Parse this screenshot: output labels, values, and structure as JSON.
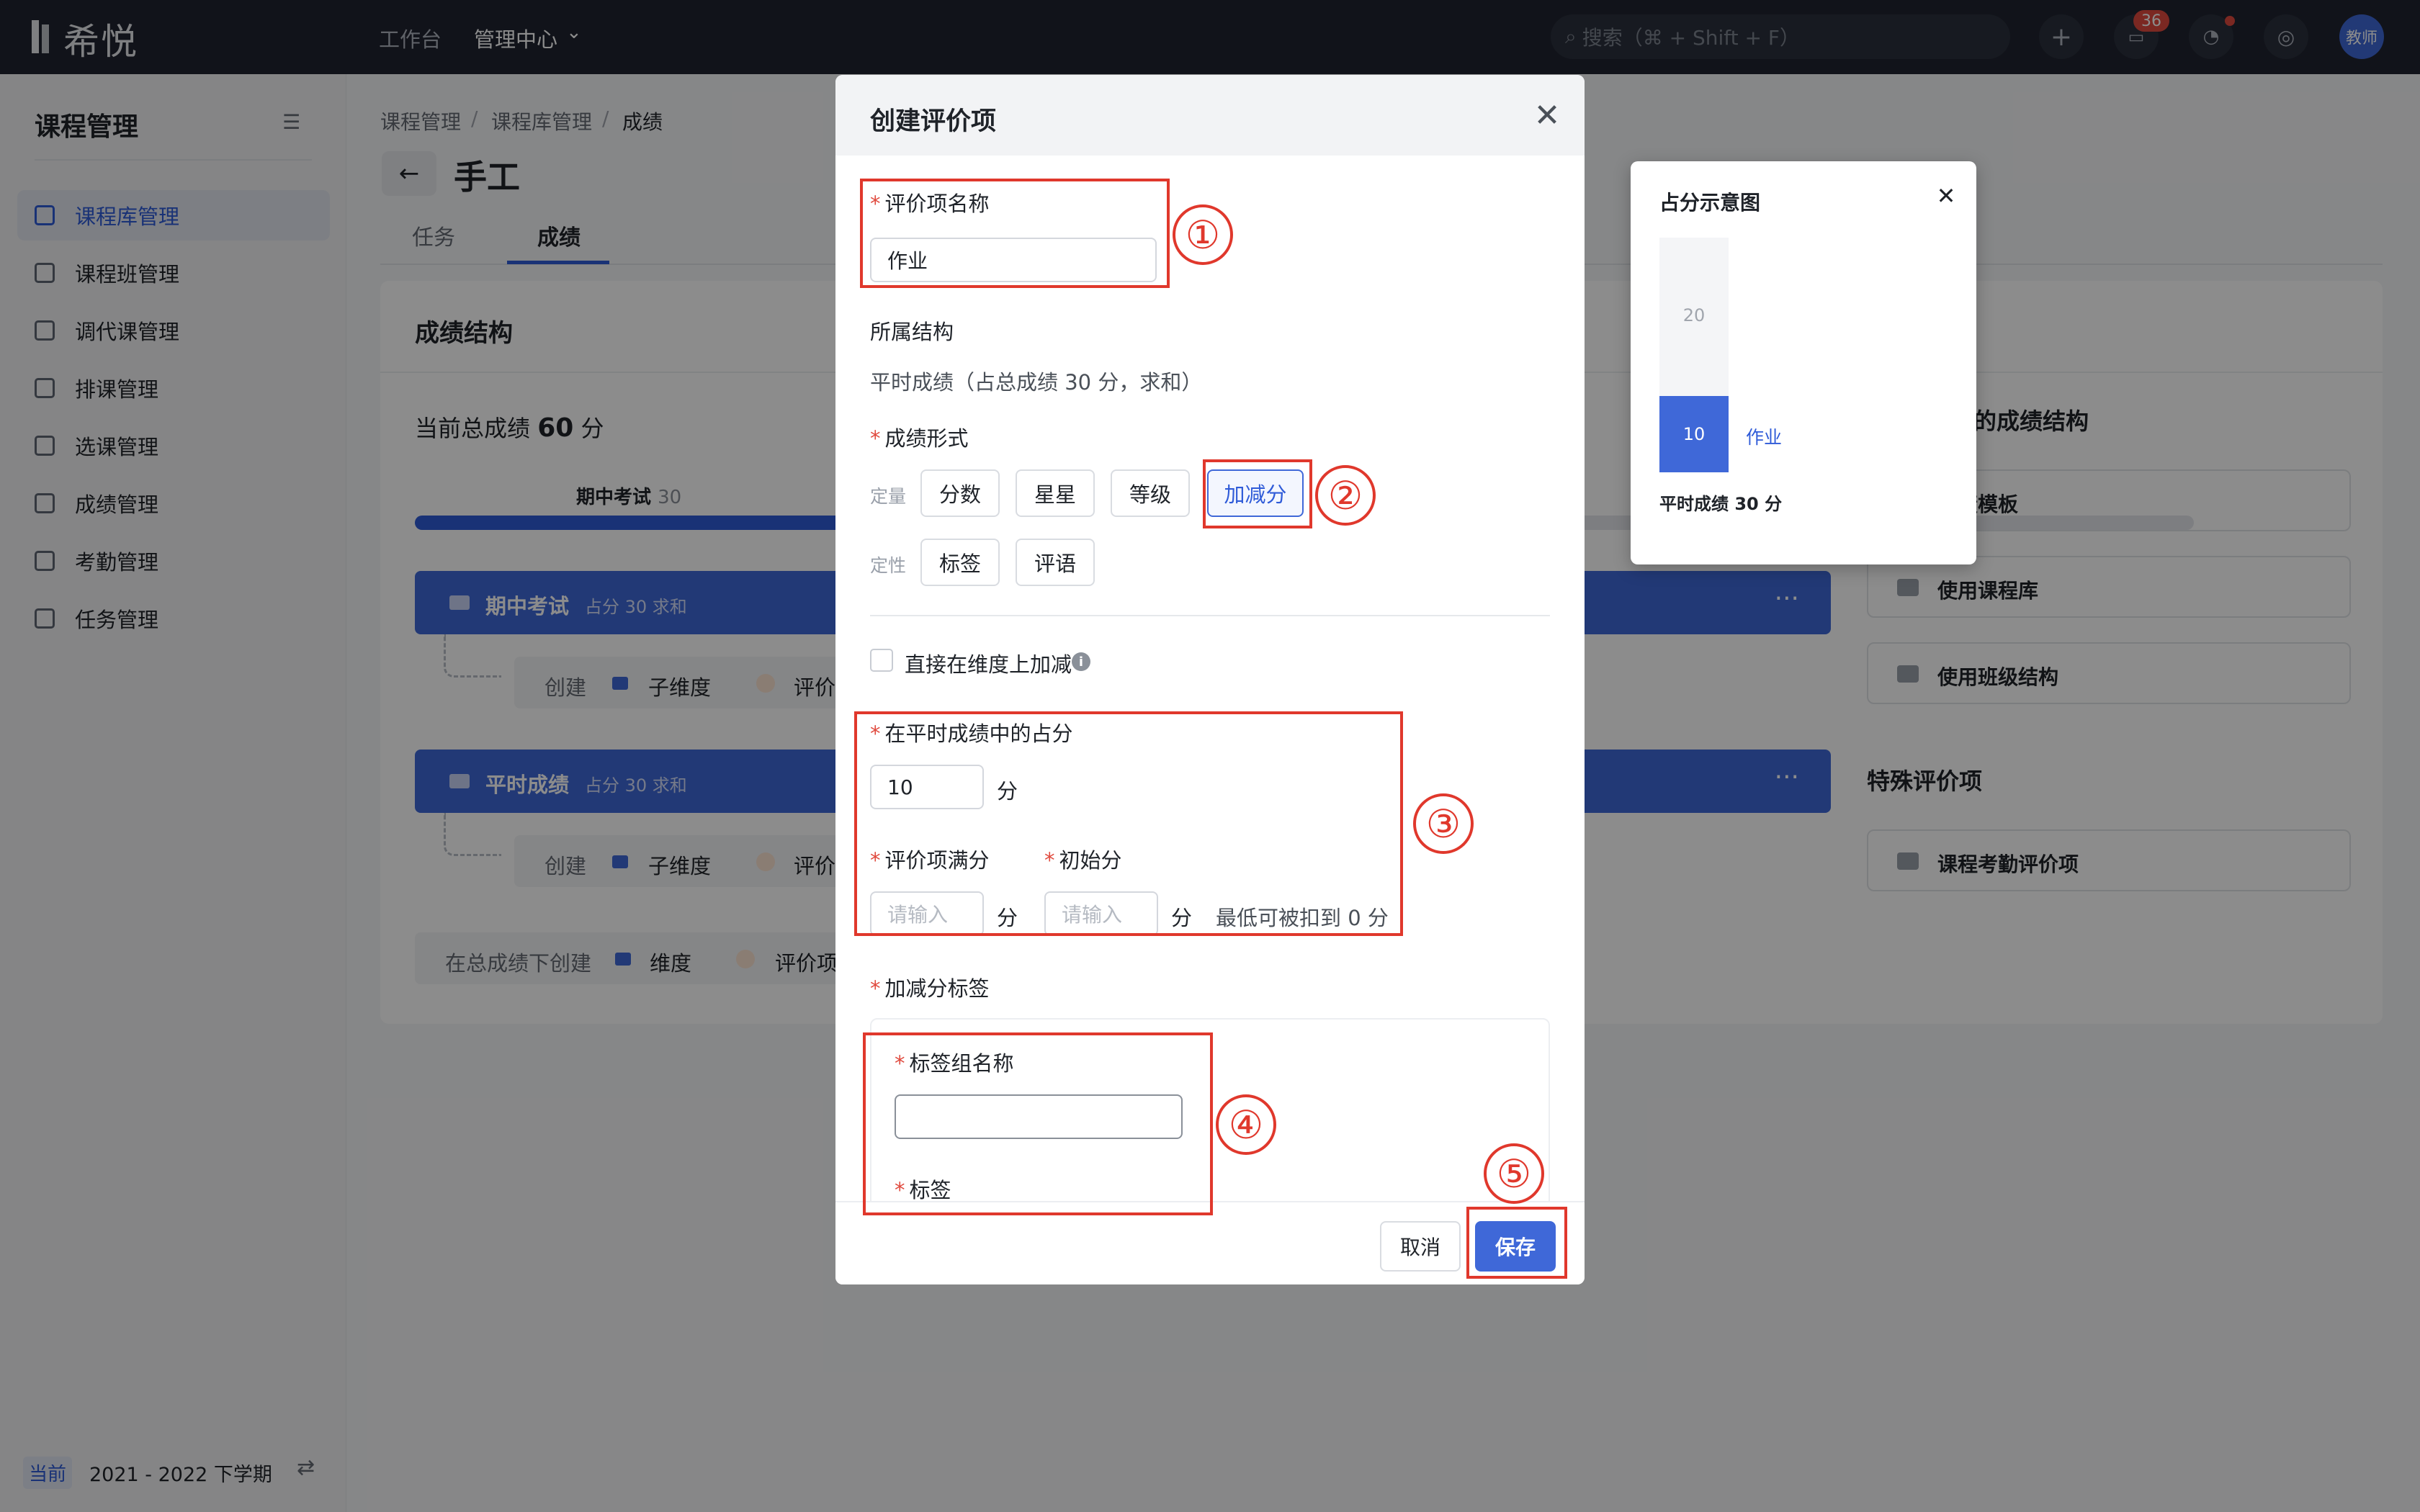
{
  "topbar": {
    "brand": "希悦",
    "nav": [
      "工作台",
      "管理中心"
    ],
    "search_placeholder": "搜索（⌘ + Shift + F）",
    "message_badge": "36",
    "avatar_label": "教师"
  },
  "sidebar": {
    "title": "课程管理",
    "items": [
      "课程库管理",
      "课程班管理",
      "调代课管理",
      "排课管理",
      "选课管理",
      "成绩管理",
      "考勤管理",
      "任务管理"
    ],
    "active_index": 0,
    "term_tag": "当前",
    "term": "2021 - 2022 下学期"
  },
  "main": {
    "breadcrumb": [
      "课程管理",
      "课程库管理",
      "成绩"
    ],
    "breadcrumb_sep": "/",
    "page_title": "手工",
    "tabs": [
      "任务",
      "成绩"
    ],
    "active_tab": 1,
    "section_title": "成绩结构",
    "total_prefix": "当前总成绩",
    "total_value": "60",
    "total_unit": "分",
    "progress": {
      "label": "期中考试",
      "value": "30",
      "fraction": 0.5
    },
    "groups": [
      {
        "name": "期中考试",
        "sub": "占分 30 求和"
      },
      {
        "name": "平时成绩",
        "sub": "占分 30 求和"
      }
    ],
    "subrow": {
      "create": "创建",
      "sub_dim": "子维度",
      "eval": "评价"
    },
    "create_row": {
      "label": "在总成绩下创建",
      "dim": "维度",
      "eval": "评价项"
    },
    "right": {
      "struct_title_partial": "的成绩结构",
      "buttons": [
        "成绩模板",
        "使用课程库",
        "使用班级结构"
      ],
      "special_title": "特殊评价项",
      "special_buttons": [
        "课程考勤评价项"
      ]
    }
  },
  "modal": {
    "title": "创建评价项",
    "close": "✕",
    "name_label": "评价项名称",
    "name_value": "作业",
    "struct_label": "所属结构",
    "struct_value": "平时成绩（占总成绩 30 分，求和）",
    "form_label": "成绩形式",
    "quant_label": "定量",
    "quant_options": [
      "分数",
      "星星",
      "等级",
      "加减分"
    ],
    "qual_label": "定性",
    "qual_options": [
      "标签",
      "评语"
    ],
    "selected_option": "加减分",
    "direct_checkbox": "直接在维度上加减",
    "share_label": "在平时成绩中的占分",
    "share_value": "10",
    "unit": "分",
    "full_label": "评价项满分",
    "full_placeholder": "请输入",
    "init_label": "初始分",
    "init_placeholder": "请输入",
    "min_note": "最低可被扣到 0 分",
    "tags_label": "加减分标签",
    "tag_group_label": "标签组名称",
    "tag_label": "标签",
    "cancel": "取消",
    "save": "保存"
  },
  "popover": {
    "title": "占分示意图",
    "close": "✕",
    "bar_value": "10",
    "rest_value": "20",
    "bar_name": "作业",
    "footer": "平时成绩 30 分"
  },
  "annotations": [
    "①",
    "②",
    "③",
    "④",
    "⑤"
  ],
  "colors": {
    "accent": "#3f68d8",
    "annotation": "#e0382c",
    "topbar": "#1f2430"
  }
}
